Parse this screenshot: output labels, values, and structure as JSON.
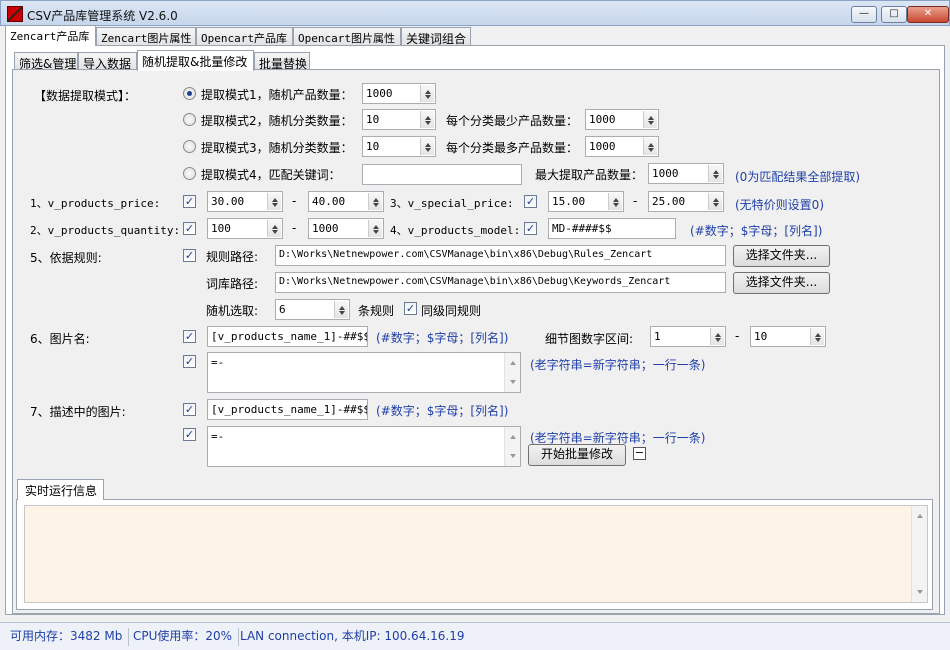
{
  "window": {
    "title": "CSV产品库管理系统 V2.6.0",
    "controls": {
      "minimize": "—",
      "maximize": "□",
      "close": "✕"
    }
  },
  "main_tabs": [
    {
      "label": "Zencart产品库",
      "selected": true
    },
    {
      "label": "Zencart图片属性",
      "selected": false
    },
    {
      "label": "Opencart产品库",
      "selected": false
    },
    {
      "label": "Opencart图片属性",
      "selected": false
    },
    {
      "label": "关键词组合",
      "selected": false
    }
  ],
  "sub_tabs": [
    {
      "label": "筛选&管理",
      "selected": false
    },
    {
      "label": "导入数据",
      "selected": false
    },
    {
      "label": "随机提取&批量修改",
      "selected": true
    },
    {
      "label": "批量替换",
      "selected": false
    }
  ],
  "extract": {
    "section_label": "【数据提取模式】：",
    "mode1": {
      "label": "提取模式1，随机产品数量：",
      "value": "1000",
      "selected": true
    },
    "mode2": {
      "label": "提取模式2，随机分类数量：",
      "value": "10",
      "extra_label": "每个分类最少产品数量：",
      "extra_value": "1000"
    },
    "mode3": {
      "label": "提取模式3，随机分类数量：",
      "value": "10",
      "extra_label": "每个分类最多产品数量：",
      "extra_value": "1000"
    },
    "mode4": {
      "label": "提取模式4，匹配关键词：",
      "value": "",
      "max_label": "最大提取产品数量：",
      "max_value": "1000",
      "hint": "(0为匹配结果全部提取)"
    }
  },
  "rows": {
    "price": {
      "label": "1、v_products_price:",
      "checked": true,
      "min": "30.00",
      "dash": "-",
      "max": "40.00"
    },
    "special_price": {
      "label": "3、v_special_price:",
      "checked": true,
      "min": "15.00",
      "dash": "-",
      "max": "25.00",
      "hint": "(无特价则设置0)"
    },
    "quantity": {
      "label": "2、v_products_quantity:",
      "checked": true,
      "min": "100",
      "dash": "-",
      "max": "1000"
    },
    "model": {
      "label": "4、v_products_model:",
      "checked": true,
      "value": "MD-####$$",
      "hint": "(#数字；$字母；[列名])"
    },
    "rules": {
      "label": "5、依据规则:",
      "checked": true,
      "rule_path_label": "规则路径:",
      "rule_path": "D:\\Works\\Netnewpower.com\\CSVManage\\bin\\x86\\Debug\\Rules_Zencart",
      "dict_path_label": "词库路径:",
      "dict_path": "D:\\Works\\Netnewpower.com\\CSVManage\\bin\\x86\\Debug\\Keywords_Zencart",
      "choose_button": "选择文件夹...",
      "random_label": "随机选取:",
      "random_value": "6",
      "rules_unit": "条规则",
      "same_level_checked": true,
      "same_level_label": "同级同规则"
    },
    "image_name": {
      "label": "6、图片名:",
      "checked": true,
      "value": "[v_products_name_1]-##$$",
      "hint": "(#数字；$字母；[列名])",
      "detail_label": "细节图数字区间:",
      "detail_min": "1",
      "dash": "-",
      "detail_max": "10",
      "replace_checked": true,
      "replace_text": "=-",
      "replace_hint": "(老字符串=新字符串；一行一条)"
    },
    "desc_image": {
      "label": "7、描述中的图片:",
      "checked": true,
      "value": "[v_products_name_1]-##$$",
      "hint": "(#数字；$字母；[列名])",
      "replace_checked": true,
      "replace_text": "=-",
      "replace_hint": "(老字符串=新字符串；一行一条)"
    }
  },
  "start_button": "开始批量修改",
  "collapse_button": "−",
  "log": {
    "tab_label": "实时运行信息",
    "content": ""
  },
  "status_bar": {
    "memory": "可用内存：3482 Mb",
    "cpu": "CPU使用率：20%",
    "network": "LAN connection, 本机IP: 100.64.16.19"
  },
  "colors": {
    "hint_blue": "#1f3fa8",
    "log_bg": "#fdf3e6",
    "titlebar": "#c6d6ec"
  }
}
